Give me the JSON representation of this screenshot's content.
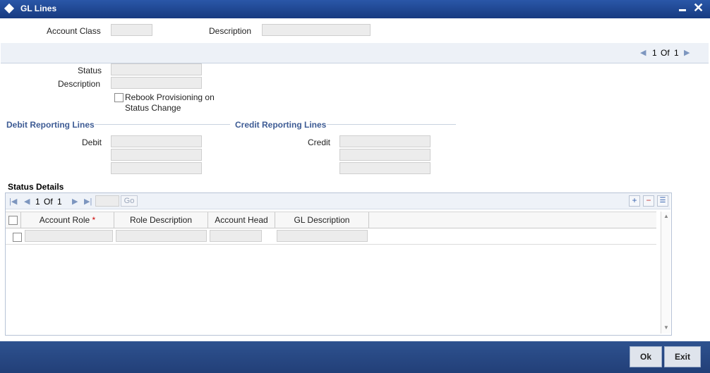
{
  "window": {
    "title": "GL Lines"
  },
  "header": {
    "account_class_label": "Account Class",
    "account_class_value": "",
    "description_label": "Description",
    "description_value": ""
  },
  "record_nav": {
    "current": "1",
    "of_label": "Of",
    "total": "1"
  },
  "status_section": {
    "status_label": "Status",
    "status_value": "",
    "description_label": "Description",
    "description_value": "",
    "rebook_label_line1": "Rebook Provisioning on",
    "rebook_label_line2": "Status Change",
    "rebook_checked": false
  },
  "debit": {
    "legend": "Debit Reporting Lines",
    "label": "Debit",
    "values": [
      "",
      "",
      ""
    ]
  },
  "credit": {
    "legend": "Credit Reporting Lines",
    "label": "Credit",
    "values": [
      "",
      "",
      ""
    ]
  },
  "status_details": {
    "title": "Status Details",
    "pager": {
      "current": "1",
      "of_label": "Of",
      "total": "1",
      "go_label": "Go"
    },
    "columns": [
      "Account Role",
      "Role Description",
      "Account Head",
      "GL Description"
    ],
    "required_marker": "*",
    "rows": [
      {
        "account_role": "",
        "role_description": "",
        "account_head": "",
        "gl_description": ""
      }
    ]
  },
  "footer": {
    "ok_label": "Ok",
    "exit_label": "Exit"
  },
  "colors": {
    "title_bar": "#1b3f8b",
    "legend_text": "#3d5b94",
    "footer_bar": "#2b4d8f",
    "required": "#cc0000"
  }
}
